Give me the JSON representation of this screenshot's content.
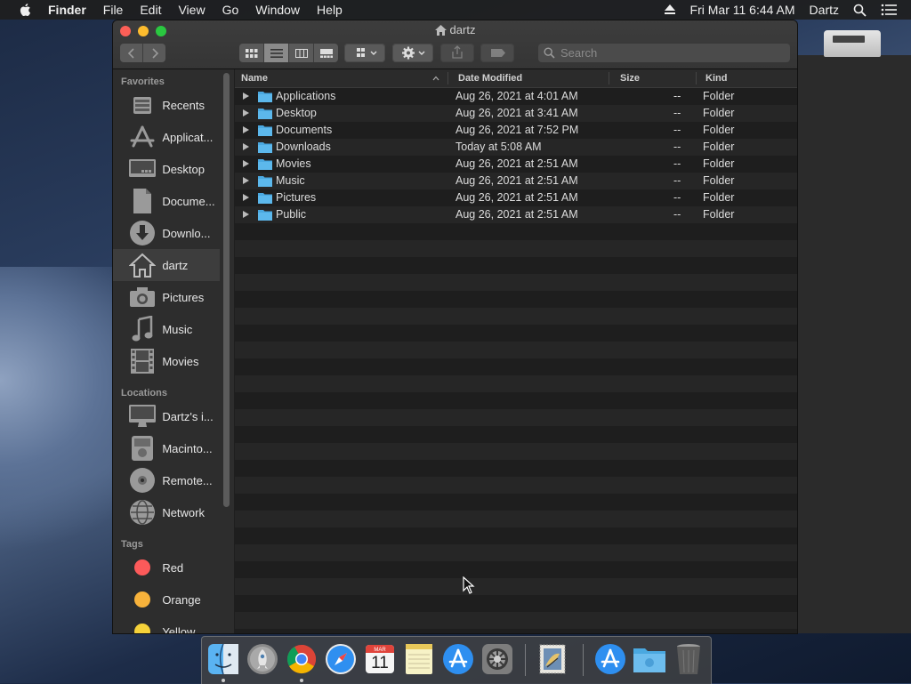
{
  "menubar": {
    "app": "Finder",
    "items": [
      "File",
      "Edit",
      "View",
      "Go",
      "Window",
      "Help"
    ],
    "datetime": "Fri Mar 11  6:44 AM",
    "user": "Dartz"
  },
  "window": {
    "title": "dartz",
    "search_placeholder": "Search"
  },
  "sidebar": {
    "favorites_heading": "Favorites",
    "favorites": [
      {
        "label": "Recents",
        "icon": "clock-icon"
      },
      {
        "label": "Applicat...",
        "icon": "applications-icon"
      },
      {
        "label": "Desktop",
        "icon": "desktop-icon"
      },
      {
        "label": "Docume...",
        "icon": "document-icon"
      },
      {
        "label": "Downlo...",
        "icon": "download-icon"
      },
      {
        "label": "dartz",
        "icon": "home-icon",
        "selected": true
      },
      {
        "label": "Pictures",
        "icon": "camera-icon"
      },
      {
        "label": "Music",
        "icon": "music-note-icon"
      },
      {
        "label": "Movies",
        "icon": "film-icon"
      }
    ],
    "locations_heading": "Locations",
    "locations": [
      {
        "label": "Dartz's i...",
        "icon": "imac-icon"
      },
      {
        "label": "Macinto...",
        "icon": "hard-drive-icon"
      },
      {
        "label": "Remote...",
        "icon": "disc-icon"
      },
      {
        "label": "Network",
        "icon": "globe-icon"
      }
    ],
    "tags_heading": "Tags",
    "tags": [
      {
        "label": "Red",
        "color": "#fc5a5a"
      },
      {
        "label": "Orange",
        "color": "#f7b23b"
      },
      {
        "label": "Yellow",
        "color": "#f5d23a"
      }
    ]
  },
  "list": {
    "columns": {
      "name": "Name",
      "date": "Date Modified",
      "size": "Size",
      "kind": "Kind"
    },
    "rows": [
      {
        "name": "Applications",
        "date": "Aug 26, 2021 at 4:01 AM",
        "size": "--",
        "kind": "Folder"
      },
      {
        "name": "Desktop",
        "date": "Aug 26, 2021 at 3:41 AM",
        "size": "--",
        "kind": "Folder"
      },
      {
        "name": "Documents",
        "date": "Aug 26, 2021 at 7:52 PM",
        "size": "--",
        "kind": "Folder"
      },
      {
        "name": "Downloads",
        "date": "Today at 5:08 AM",
        "size": "--",
        "kind": "Folder"
      },
      {
        "name": "Movies",
        "date": "Aug 26, 2021 at 2:51 AM",
        "size": "--",
        "kind": "Folder"
      },
      {
        "name": "Music",
        "date": "Aug 26, 2021 at 2:51 AM",
        "size": "--",
        "kind": "Folder"
      },
      {
        "name": "Pictures",
        "date": "Aug 26, 2021 at 2:51 AM",
        "size": "--",
        "kind": "Folder"
      },
      {
        "name": "Public",
        "date": "Aug 26, 2021 at 2:51 AM",
        "size": "--",
        "kind": "Folder"
      }
    ]
  },
  "dock": {
    "items": [
      "finder-icon",
      "launchpad-icon",
      "chrome-icon",
      "safari-icon",
      "calendar-icon",
      "notes-icon",
      "app-store-icon",
      "system-preferences-icon",
      "mail-stamp-icon",
      "app-store-folder-icon",
      "folder-icon",
      "trash-icon"
    ],
    "calendar": {
      "month": "MAR",
      "day": "11"
    }
  },
  "colors": {
    "folder": "#4aa8e0",
    "selection": "#3d3d3d"
  }
}
